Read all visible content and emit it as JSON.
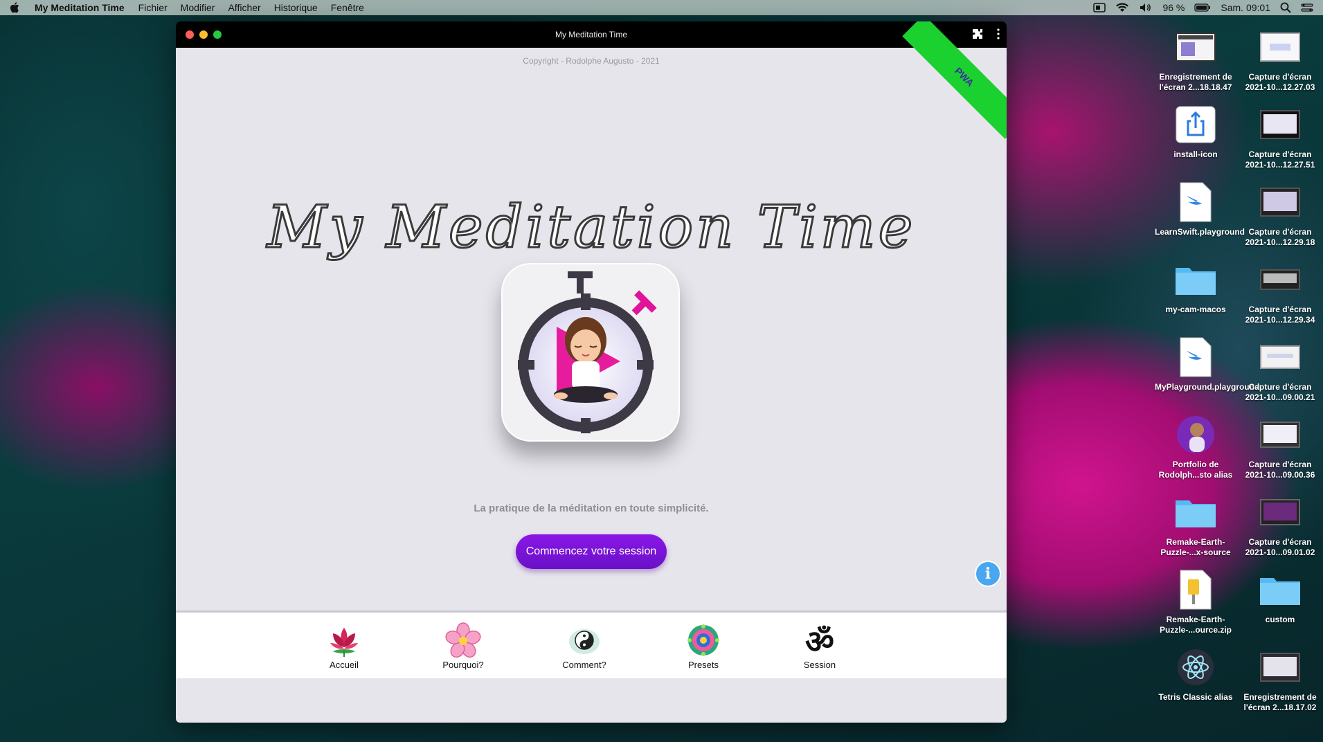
{
  "menubar": {
    "app_name": "My Meditation Time",
    "items": [
      "Fichier",
      "Modifier",
      "Afficher",
      "Historique",
      "Fenêtre"
    ],
    "battery": "96 %",
    "clock": "Sam. 09:01"
  },
  "window": {
    "title": "My Meditation Time",
    "copyright": "Copyright - Rodolphe Augusto - 2021",
    "ribbon": "PWA",
    "hero_title": "My Meditation Time",
    "tagline": "La pratique de la méditation en toute simplicité.",
    "cta_label": "Commencez votre session",
    "info_symbol": "i"
  },
  "bottom_nav": {
    "items": [
      {
        "label": "Accueil",
        "icon": "lotus-icon"
      },
      {
        "label": "Pourquoi?",
        "icon": "flower-icon"
      },
      {
        "label": "Comment?",
        "icon": "yin-yang-icon"
      },
      {
        "label": "Presets",
        "icon": "mandala-icon"
      },
      {
        "label": "Session",
        "icon": "om-icon"
      }
    ]
  },
  "desktop": {
    "icons": [
      {
        "label": "Enregistrement de l'écran 2...18.18.47"
      },
      {
        "label": "Capture d'écran 2021-10...12.27.03"
      },
      {
        "label": "install-icon"
      },
      {
        "label": "Capture d'écran 2021-10...12.27.51"
      },
      {
        "label": "LearnSwift.playground"
      },
      {
        "label": "Capture d'écran 2021-10...12.29.18"
      },
      {
        "label": "my-cam-macos"
      },
      {
        "label": "Capture d'écran 2021-10...12.29.34"
      },
      {
        "label": "MyPlayground.playground"
      },
      {
        "label": "Capture d'écran 2021-10...09.00.21"
      },
      {
        "label": "Portfolio de Rodolph...sto alias"
      },
      {
        "label": "Capture d'écran 2021-10...09.00.36"
      },
      {
        "label": "Remake-Earth-Puzzle-...x-source"
      },
      {
        "label": "Capture d'écran 2021-10...09.01.02"
      },
      {
        "label": "Remake-Earth-Puzzle-...ource.zip"
      },
      {
        "label": "custom"
      },
      {
        "label": "Tetris Classic alias"
      },
      {
        "label": "Enregistrement de l'écran 2...18.17.02"
      }
    ]
  }
}
